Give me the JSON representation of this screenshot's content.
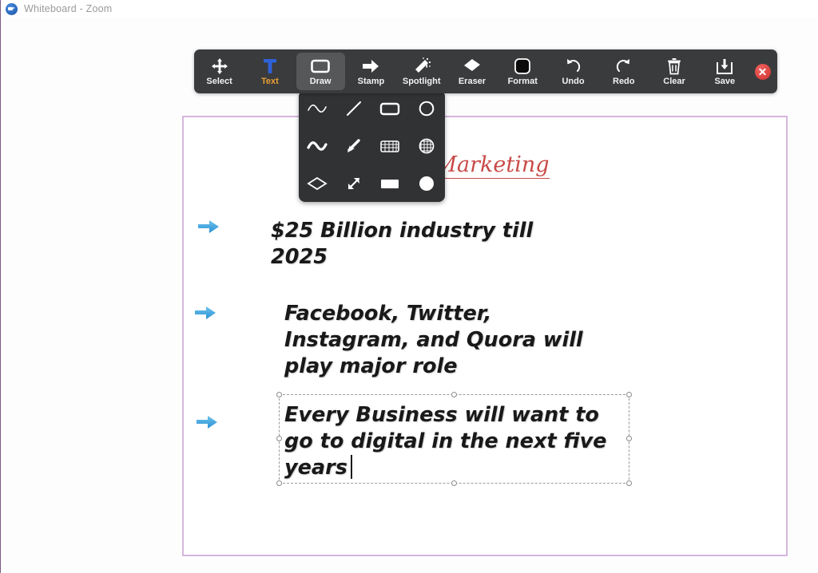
{
  "window": {
    "title": "Whiteboard - Zoom",
    "logo_icon": "zoom-camera-icon"
  },
  "toolbar": {
    "items": [
      {
        "label": "Select",
        "icon": "move-arrows-icon",
        "active": false
      },
      {
        "label": "Text",
        "icon": "text-t-icon",
        "active": false
      },
      {
        "label": "Draw",
        "icon": "rectangle-icon",
        "active": true
      },
      {
        "label": "Stamp",
        "icon": "arrow-right-icon",
        "active": false
      },
      {
        "label": "Spotlight",
        "icon": "magic-wand-icon",
        "active": false
      },
      {
        "label": "Eraser",
        "icon": "eraser-icon",
        "active": false
      },
      {
        "label": "Format",
        "icon": "color-swatch-icon",
        "active": false
      },
      {
        "label": "Undo",
        "icon": "undo-arrow-icon",
        "active": false
      },
      {
        "label": "Redo",
        "icon": "redo-arrow-icon",
        "active": false
      },
      {
        "label": "Clear",
        "icon": "trash-can-icon",
        "active": false
      },
      {
        "label": "Save",
        "icon": "save-download-icon",
        "active": false
      }
    ],
    "close_button": "close-icon",
    "background_color": "#3a3b3d",
    "active_background_color": "#565759",
    "text_tool_label_color": "#e89f32"
  },
  "draw_panel": {
    "background_color": "#313234",
    "options": [
      {
        "name": "thin-squiggle-icon"
      },
      {
        "name": "line-icon"
      },
      {
        "name": "rectangle-outline-icon"
      },
      {
        "name": "circle-outline-icon"
      },
      {
        "name": "thick-squiggle-icon"
      },
      {
        "name": "arrow-diagonal-icon"
      },
      {
        "name": "grid-rectangle-icon"
      },
      {
        "name": "grid-circle-icon"
      },
      {
        "name": "diamond-outline-icon"
      },
      {
        "name": "double-arrow-icon"
      },
      {
        "name": "filled-rectangle-icon"
      },
      {
        "name": "filled-circle-icon"
      }
    ]
  },
  "whiteboard": {
    "border_color": "#d6b6dd",
    "title": "Digital Marketing",
    "title_color": "#c94a47",
    "stamp_icon": "blue-arrow-stamp-icon",
    "bullets": [
      {
        "text": "$25 Billion industry till\n2025"
      },
      {
        "text": "Facebook, Twitter,\nInstagram, and Quora will\nplay major role"
      },
      {
        "text": "Every Business will want to\ngo to digital in the next five\nyears",
        "selected": true
      }
    ]
  }
}
